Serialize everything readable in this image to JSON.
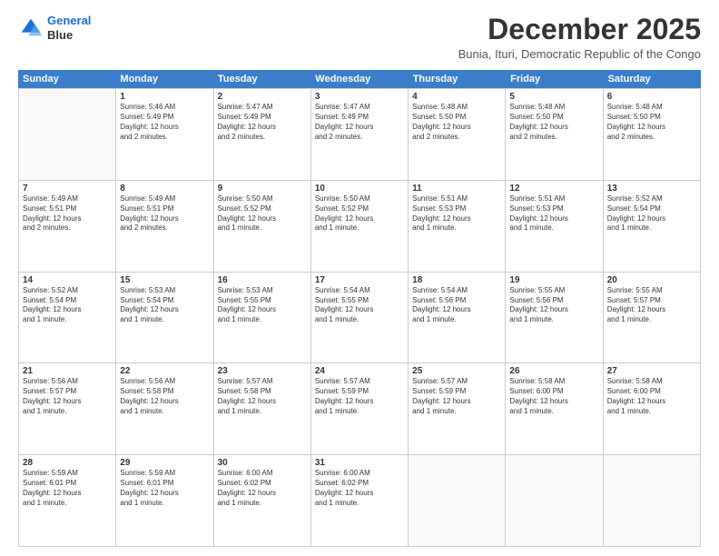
{
  "logo": {
    "line1": "General",
    "line2": "Blue"
  },
  "title": "December 2025",
  "subtitle": "Bunia, Ituri, Democratic Republic of the Congo",
  "header_days": [
    "Sunday",
    "Monday",
    "Tuesday",
    "Wednesday",
    "Thursday",
    "Friday",
    "Saturday"
  ],
  "rows": [
    [
      {
        "day": "",
        "text": ""
      },
      {
        "day": "1",
        "text": "Sunrise: 5:46 AM\nSunset: 5:49 PM\nDaylight: 12 hours\nand 2 minutes."
      },
      {
        "day": "2",
        "text": "Sunrise: 5:47 AM\nSunset: 5:49 PM\nDaylight: 12 hours\nand 2 minutes."
      },
      {
        "day": "3",
        "text": "Sunrise: 5:47 AM\nSunset: 5:49 PM\nDaylight: 12 hours\nand 2 minutes."
      },
      {
        "day": "4",
        "text": "Sunrise: 5:48 AM\nSunset: 5:50 PM\nDaylight: 12 hours\nand 2 minutes."
      },
      {
        "day": "5",
        "text": "Sunrise: 5:48 AM\nSunset: 5:50 PM\nDaylight: 12 hours\nand 2 minutes."
      },
      {
        "day": "6",
        "text": "Sunrise: 5:48 AM\nSunset: 5:50 PM\nDaylight: 12 hours\nand 2 minutes."
      }
    ],
    [
      {
        "day": "7",
        "text": "Sunrise: 5:49 AM\nSunset: 5:51 PM\nDaylight: 12 hours\nand 2 minutes."
      },
      {
        "day": "8",
        "text": "Sunrise: 5:49 AM\nSunset: 5:51 PM\nDaylight: 12 hours\nand 2 minutes."
      },
      {
        "day": "9",
        "text": "Sunrise: 5:50 AM\nSunset: 5:52 PM\nDaylight: 12 hours\nand 1 minute."
      },
      {
        "day": "10",
        "text": "Sunrise: 5:50 AM\nSunset: 5:52 PM\nDaylight: 12 hours\nand 1 minute."
      },
      {
        "day": "11",
        "text": "Sunrise: 5:51 AM\nSunset: 5:53 PM\nDaylight: 12 hours\nand 1 minute."
      },
      {
        "day": "12",
        "text": "Sunrise: 5:51 AM\nSunset: 5:53 PM\nDaylight: 12 hours\nand 1 minute."
      },
      {
        "day": "13",
        "text": "Sunrise: 5:52 AM\nSunset: 5:54 PM\nDaylight: 12 hours\nand 1 minute."
      }
    ],
    [
      {
        "day": "14",
        "text": "Sunrise: 5:52 AM\nSunset: 5:54 PM\nDaylight: 12 hours\nand 1 minute."
      },
      {
        "day": "15",
        "text": "Sunrise: 5:53 AM\nSunset: 5:54 PM\nDaylight: 12 hours\nand 1 minute."
      },
      {
        "day": "16",
        "text": "Sunrise: 5:53 AM\nSunset: 5:55 PM\nDaylight: 12 hours\nand 1 minute."
      },
      {
        "day": "17",
        "text": "Sunrise: 5:54 AM\nSunset: 5:55 PM\nDaylight: 12 hours\nand 1 minute."
      },
      {
        "day": "18",
        "text": "Sunrise: 5:54 AM\nSunset: 5:56 PM\nDaylight: 12 hours\nand 1 minute."
      },
      {
        "day": "19",
        "text": "Sunrise: 5:55 AM\nSunset: 5:56 PM\nDaylight: 12 hours\nand 1 minute."
      },
      {
        "day": "20",
        "text": "Sunrise: 5:55 AM\nSunset: 5:57 PM\nDaylight: 12 hours\nand 1 minute."
      }
    ],
    [
      {
        "day": "21",
        "text": "Sunrise: 5:56 AM\nSunset: 5:57 PM\nDaylight: 12 hours\nand 1 minute."
      },
      {
        "day": "22",
        "text": "Sunrise: 5:56 AM\nSunset: 5:58 PM\nDaylight: 12 hours\nand 1 minute."
      },
      {
        "day": "23",
        "text": "Sunrise: 5:57 AM\nSunset: 5:58 PM\nDaylight: 12 hours\nand 1 minute."
      },
      {
        "day": "24",
        "text": "Sunrise: 5:57 AM\nSunset: 5:59 PM\nDaylight: 12 hours\nand 1 minute."
      },
      {
        "day": "25",
        "text": "Sunrise: 5:57 AM\nSunset: 5:59 PM\nDaylight: 12 hours\nand 1 minute."
      },
      {
        "day": "26",
        "text": "Sunrise: 5:58 AM\nSunset: 6:00 PM\nDaylight: 12 hours\nand 1 minute."
      },
      {
        "day": "27",
        "text": "Sunrise: 5:58 AM\nSunset: 6:00 PM\nDaylight: 12 hours\nand 1 minute."
      }
    ],
    [
      {
        "day": "28",
        "text": "Sunrise: 5:59 AM\nSunset: 6:01 PM\nDaylight: 12 hours\nand 1 minute."
      },
      {
        "day": "29",
        "text": "Sunrise: 5:59 AM\nSunset: 6:01 PM\nDaylight: 12 hours\nand 1 minute."
      },
      {
        "day": "30",
        "text": "Sunrise: 6:00 AM\nSunset: 6:02 PM\nDaylight: 12 hours\nand 1 minute."
      },
      {
        "day": "31",
        "text": "Sunrise: 6:00 AM\nSunset: 6:02 PM\nDaylight: 12 hours\nand 1 minute."
      },
      {
        "day": "",
        "text": ""
      },
      {
        "day": "",
        "text": ""
      },
      {
        "day": "",
        "text": ""
      }
    ]
  ]
}
